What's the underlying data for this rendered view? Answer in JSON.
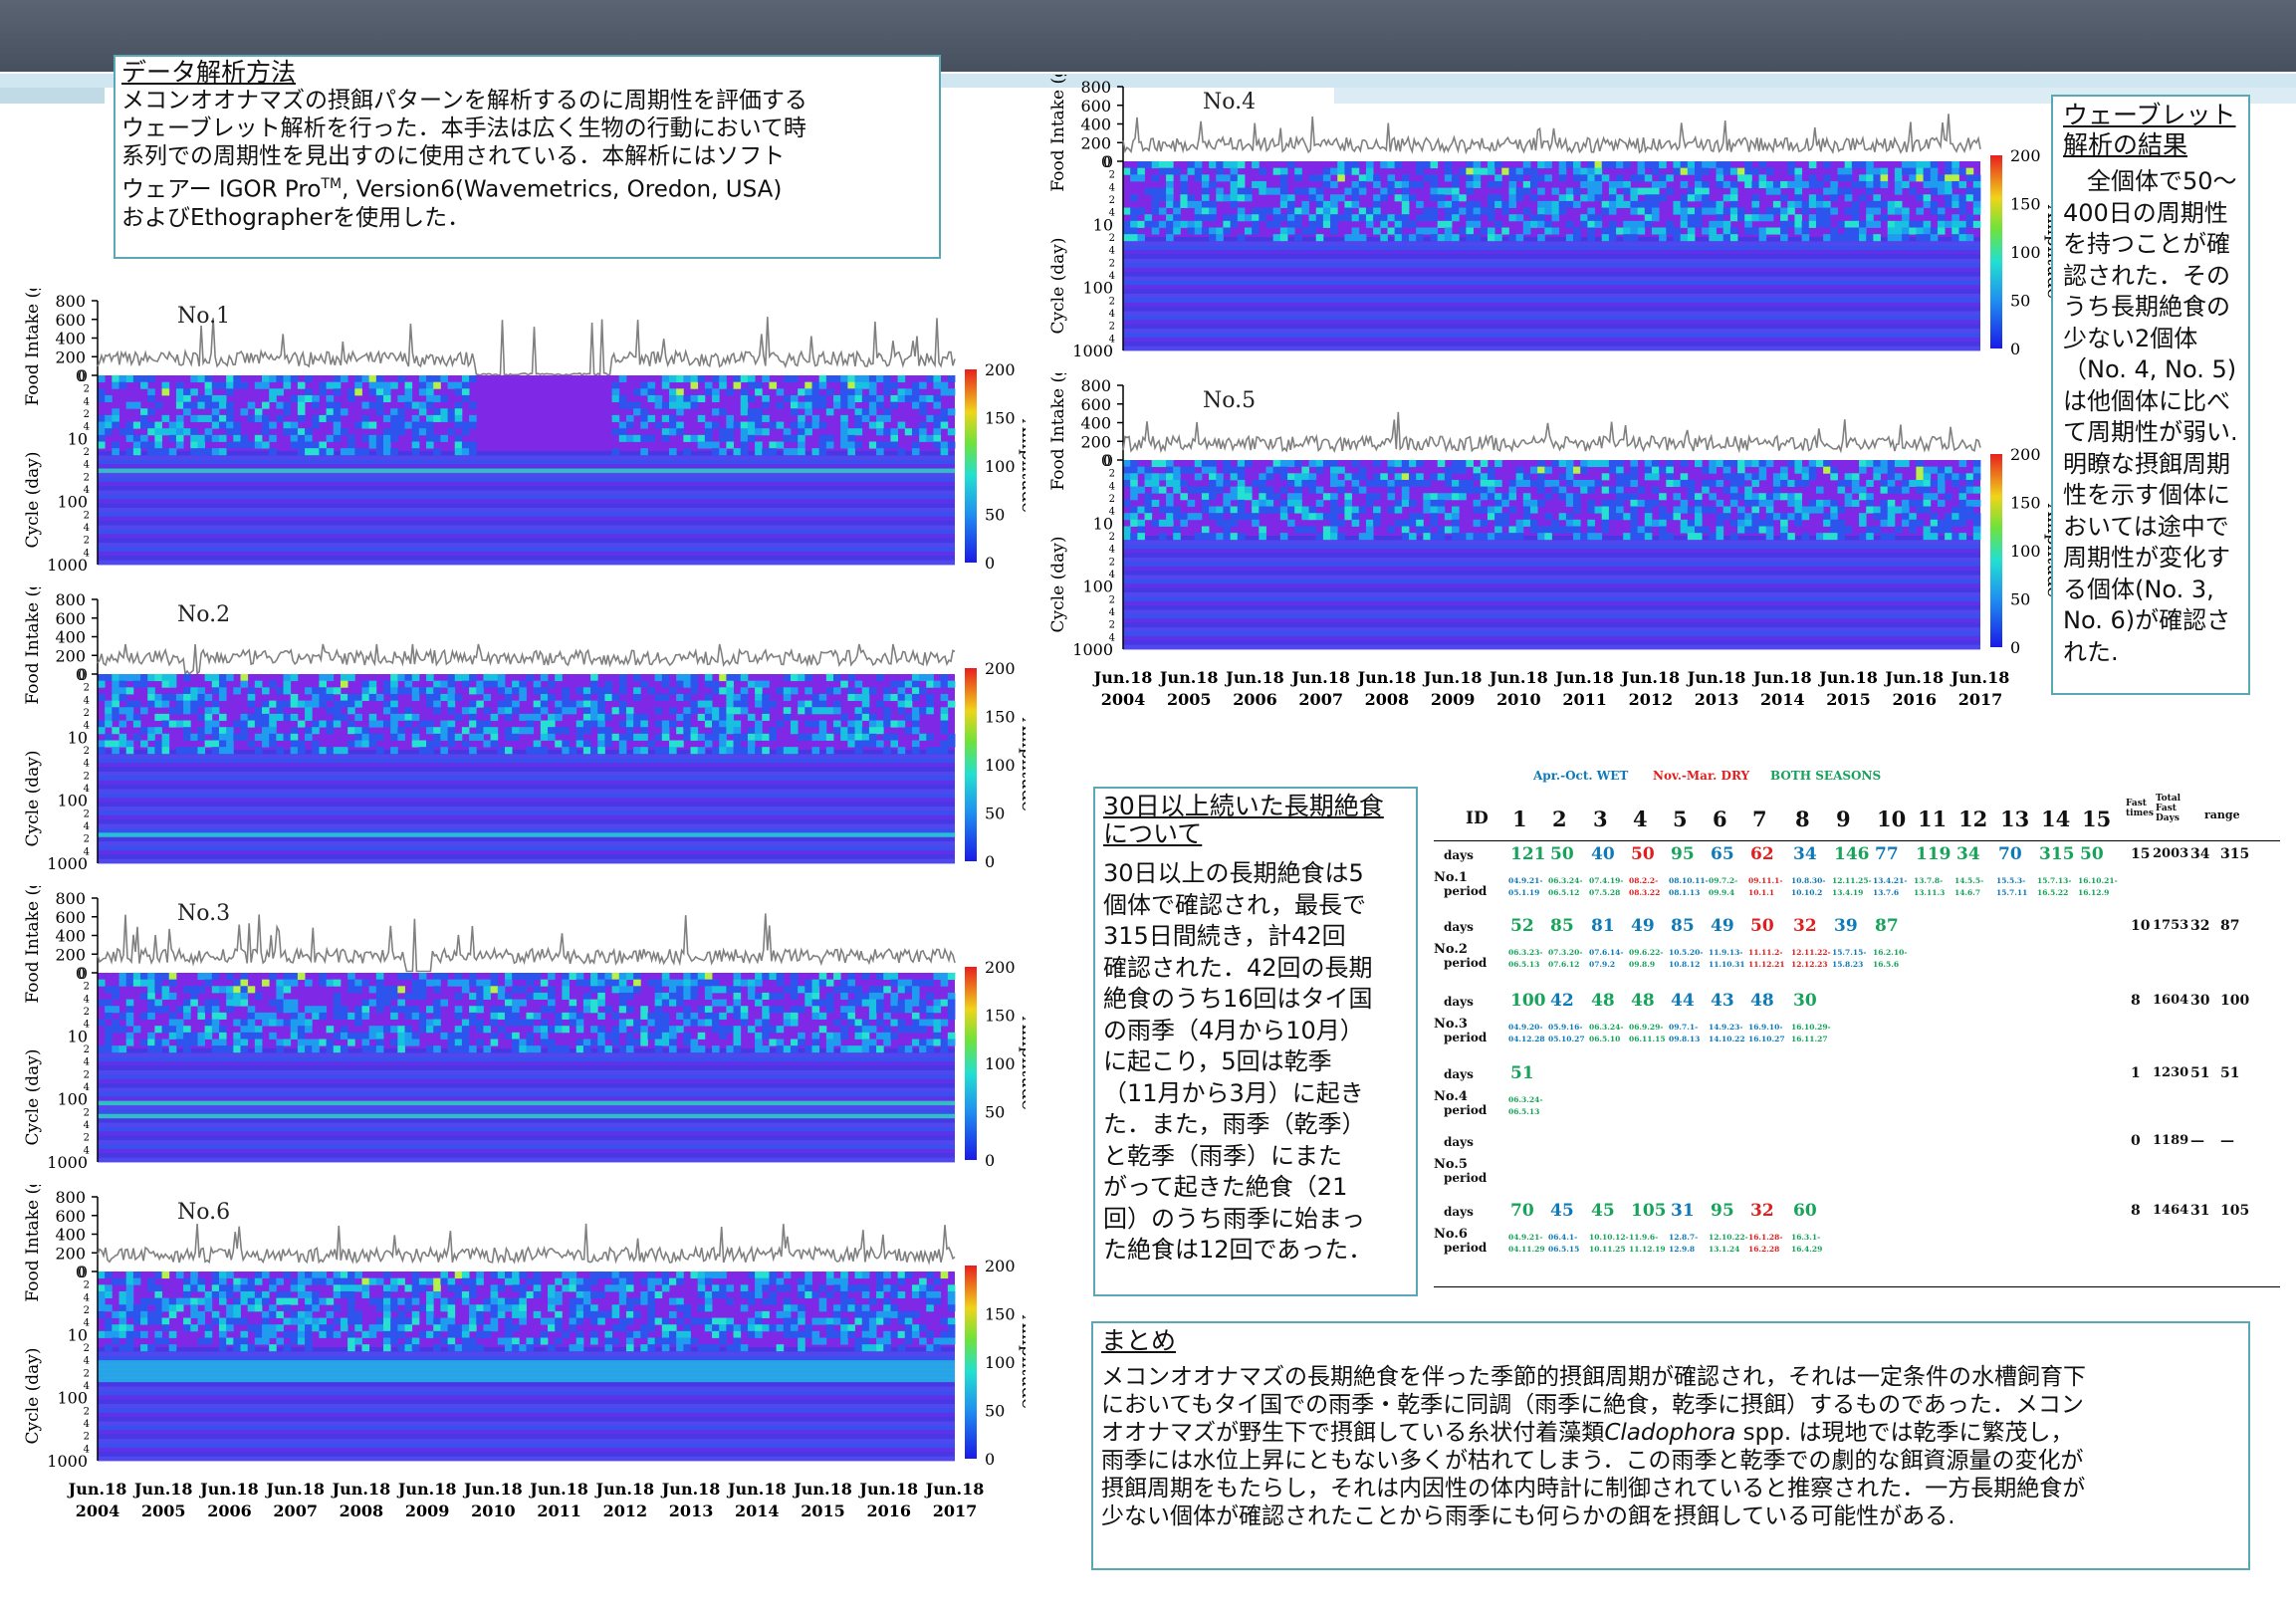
{
  "method": {
    "title": "データ解析方法",
    "body_lines": [
      "メコンオオナマズの摂餌パターンを解析するのに周期性を評価する",
      "ウェーブレット解析を行った．本手法は広く生物の行動において時",
      "系列での周期性を見出すのに使用されている．本解析にはソフト",
      "ウェアー IGOR Pro",
      "TM",
      ", Version6(Wavemetrics, Oredon, USA)",
      "およびEthographerを使用した．"
    ]
  },
  "results": {
    "title_lines": [
      "ウェーブレット",
      "解析の結果"
    ],
    "body_lines": [
      "　全個体で50～",
      "400日の周期性",
      "を持つことが確",
      "認された．その",
      "うち長期絶食の",
      "少ない2個体",
      "（No. 4, No. 5)",
      "は他個体に比べ",
      "て周期性が弱い.",
      "明瞭な摂餌周期",
      "性を示す個体に",
      "おいては途中で",
      "周期性が変化す",
      "る個体(No. 3,",
      "No. 6)が確認さ",
      "れた."
    ]
  },
  "fasting": {
    "title_lines": [
      "30日以上続いた長期絶食",
      "について"
    ],
    "body_lines": [
      "30日以上の長期絶食は5",
      "個体で確認され，最長で",
      "315日間続き，計42回",
      "確認された．42回の長期",
      "絶食のうち16回はタイ国",
      "の雨季（4月から10月）",
      "に起こり，5回は乾季",
      "（11月から3月）に起き",
      "た．また，雨季（乾季）",
      "と乾季（雨季）にまた",
      "がって起きた絶食（21",
      "回）のうち雨季に始まっ",
      "た絶食は12回であった．"
    ]
  },
  "summary": {
    "title": "まとめ",
    "body_lines": [
      "メコンオオナマズの長期絶食を伴った季節的摂餌周期が確認され，それは一定条件の水槽飼育下",
      "においてもタイ国での雨季・乾季に同調（雨季に絶食，乾季に摂餌）するものであった．メコン",
      "オオナマズが野生下で摂餌している糸状付着藻類",
      "Cladophora",
      " spp. は現地では乾季に繁茂し，",
      "雨季には水位上昇にともない多くが枯れてしまう．この雨季と乾季での劇的な餌資源量の変化が",
      "摂餌周期をもたらし，それは内因性の体内時計に制御されていると推察された．一方長期絶食が",
      "少ない個体が確認されたことから雨季にも何らかの餌を摂餌している可能性がある."
    ]
  },
  "chart_data": [
    {
      "type": "heatmap",
      "label": "No.1",
      "food_ylabel": "Food Intake (g)",
      "food_yticks": [
        0,
        200,
        400,
        600,
        800
      ],
      "cycle_ylabel": "Cycle (day)",
      "cycle_yticks": [
        "1",
        "10",
        "100",
        "1000"
      ],
      "colorbar_label": "Amplitude",
      "colorbar_ticks": [
        0,
        50,
        100,
        150,
        200
      ]
    },
    {
      "type": "heatmap",
      "label": "No.2",
      "food_ylabel": "Food Intake (g)",
      "food_yticks": [
        0,
        200,
        400,
        600,
        800
      ],
      "cycle_ylabel": "Cycle (day)",
      "cycle_yticks": [
        "1",
        "10",
        "100",
        "1000"
      ],
      "colorbar_label": "Amplitude",
      "colorbar_ticks": [
        0,
        50,
        100,
        150,
        200
      ]
    },
    {
      "type": "heatmap",
      "label": "No.3",
      "food_ylabel": "Food Intake (g)",
      "food_yticks": [
        0,
        200,
        400,
        600,
        800
      ],
      "cycle_ylabel": "Cycle (day)",
      "cycle_yticks": [
        "1",
        "10",
        "100",
        "1000"
      ],
      "colorbar_label": "Amplitude",
      "colorbar_ticks": [
        0,
        50,
        100,
        150,
        200
      ]
    },
    {
      "type": "heatmap",
      "label": "No.6",
      "food_ylabel": "Food Intake (g)",
      "food_yticks": [
        0,
        200,
        400,
        600,
        800
      ],
      "cycle_ylabel": "Cycle (day)",
      "cycle_yticks": [
        "1",
        "10",
        "100",
        "1000"
      ],
      "colorbar_label": "Amplitude",
      "colorbar_ticks": [
        0,
        50,
        100,
        150,
        200
      ],
      "xticks": [
        "Jun.18 2004",
        "Jun.18 2005",
        "Jun.18 2006",
        "Jun.18 2007",
        "Jun.18 2008",
        "Jun.18 2009",
        "Jun.18 2010",
        "Jun.18 2011",
        "Jun.18 2012",
        "Jun.18 2013",
        "Jun.18 2014",
        "Jun.18 2015",
        "Jun.18 2016",
        "Jun.18 2017"
      ]
    },
    {
      "type": "heatmap",
      "label": "No.4",
      "food_ylabel": "Food Intake (g)",
      "food_yticks": [
        0,
        200,
        400,
        600,
        800
      ],
      "cycle_ylabel": "Cycle (day)",
      "cycle_yticks": [
        "1",
        "10",
        "100",
        "1000"
      ],
      "colorbar_label": "Amplitude",
      "colorbar_ticks": [
        0,
        50,
        100,
        150,
        200
      ]
    },
    {
      "type": "heatmap",
      "label": "No.5",
      "food_ylabel": "Food Intake (g)",
      "food_yticks": [
        0,
        200,
        400,
        600,
        800
      ],
      "cycle_ylabel": "Cycle (day)",
      "cycle_yticks": [
        "1",
        "10",
        "100",
        "1000"
      ],
      "colorbar_label": "Amplitude",
      "colorbar_ticks": [
        0,
        50,
        100,
        150,
        200
      ],
      "xticks": [
        "Jun.18 2004",
        "Jun.18 2005",
        "Jun.18 2006",
        "Jun.18 2007",
        "Jun.18 2008",
        "Jun.18 2009",
        "Jun.18 2010",
        "Jun.18 2011",
        "Jun.18 2012",
        "Jun.18 2013",
        "Jun.18 2014",
        "Jun.18 2015",
        "Jun.18 2016",
        "Jun.18 2017"
      ]
    },
    {
      "type": "table",
      "legend": {
        "wet": "Apr.-Oct. WET",
        "dry": "Nov.-Mar. DRY",
        "both": "BOTH SEASONS"
      },
      "headers": [
        "ID",
        "1",
        "2",
        "3",
        "4",
        "5",
        "6",
        "7",
        "8",
        "9",
        "10",
        "11",
        "12",
        "13",
        "14",
        "15",
        "Fast times",
        "Total Fast Days",
        "range"
      ],
      "rows": [
        {
          "id": "No.1",
          "days": [
            [
              "121",
              "w"
            ],
            [
              "50",
              "w"
            ],
            [
              "40",
              "b"
            ],
            [
              "50",
              "d"
            ],
            [
              "95",
              "w"
            ],
            [
              "65",
              "b"
            ],
            [
              "62",
              "d"
            ],
            [
              "34",
              "b"
            ],
            [
              "146",
              "w"
            ],
            [
              "77",
              "b"
            ],
            [
              "119",
              "w"
            ],
            [
              "34",
              "w"
            ],
            [
              "70",
              "b"
            ],
            [
              "315",
              "w"
            ],
            [
              "50",
              "w"
            ]
          ],
          "periods": [
            [
              "04.9.21-05.1.19",
              "b"
            ],
            [
              "06.3.24-06.5.12",
              "w"
            ],
            [
              "07.4.19-07.5.28",
              "w"
            ],
            [
              "08.2.2-08.3.22",
              "d"
            ],
            [
              "08.10.11-08.1.13",
              "b"
            ],
            [
              "09.7.2-09.9.4",
              "w"
            ],
            [
              "09.11.1-10.1.1",
              "d"
            ],
            [
              "10.8.30-10.10.2",
              "b"
            ],
            [
              "12.11.25-13.4.19",
              "w"
            ],
            [
              "13.4.21-13.7.6",
              "b"
            ],
            [
              "13.7.8-13.11.3",
              "w"
            ],
            [
              "14.5.5-14.6.7",
              "w"
            ],
            [
              "15.5.3-15.7.11",
              "b"
            ],
            [
              "15.7.13-16.5.22",
              "w"
            ],
            [
              "16.10.21-16.12.9",
              "w"
            ]
          ],
          "fast": "15",
          "total": "2003",
          "range": "34",
          "range2": "315"
        },
        {
          "id": "No.2",
          "days": [
            [
              "52",
              "w"
            ],
            [
              "85",
              "w"
            ],
            [
              "81",
              "b"
            ],
            [
              "49",
              "b"
            ],
            [
              "85",
              "b"
            ],
            [
              "49",
              "b"
            ],
            [
              "50",
              "d"
            ],
            [
              "32",
              "d"
            ],
            [
              "39",
              "b"
            ],
            [
              "87",
              "w"
            ]
          ],
          "periods": [
            [
              "06.3.23-06.5.13",
              "w"
            ],
            [
              "07.3.20-07.6.12",
              "w"
            ],
            [
              "07.6.14-07.9.2",
              "b"
            ],
            [
              "09.6.22-09.8.9",
              "w"
            ],
            [
              "10.5.20-10.8.12",
              "b"
            ],
            [
              "11.9.13-11.10.31",
              "b"
            ],
            [
              "11.11.2-11.12.21",
              "d"
            ],
            [
              "12.11.22-12.12.23",
              "d"
            ],
            [
              "15.7.15-15.8.23",
              "b"
            ],
            [
              "16.2.10-16.5.6",
              "w"
            ]
          ],
          "fast": "10",
          "total": "1753",
          "range": "32",
          "range2": "87"
        },
        {
          "id": "No.3",
          "days": [
            [
              "100",
              "w"
            ],
            [
              "42",
              "b"
            ],
            [
              "48",
              "w"
            ],
            [
              "48",
              "w"
            ],
            [
              "44",
              "b"
            ],
            [
              "43",
              "b"
            ],
            [
              "48",
              "b"
            ],
            [
              "30",
              "w"
            ]
          ],
          "periods": [
            [
              "04.9.20-04.12.28",
              "b"
            ],
            [
              "05.9.16-05.10.27",
              "b"
            ],
            [
              "06.3.24-06.5.10",
              "w"
            ],
            [
              "06.9.29-06.11.15",
              "w"
            ],
            [
              "09.7.1-09.8.13",
              "b"
            ],
            [
              "14.9.23-14.10.22",
              "b"
            ],
            [
              "16.9.10-16.10.27",
              "b"
            ],
            [
              "16.10.29-16.11.27",
              "w"
            ]
          ],
          "fast": "8",
          "total": "1604",
          "range": "30",
          "range2": "100"
        },
        {
          "id": "No.4",
          "days": [
            [
              "51",
              "w"
            ]
          ],
          "periods": [
            [
              "06.3.24-06.5.13",
              "w"
            ]
          ],
          "fast": "1",
          "total": "1230",
          "range": "51",
          "range2": "51"
        },
        {
          "id": "No.5",
          "days": [],
          "periods": [],
          "fast": "0",
          "total": "1189",
          "range": "—",
          "range2": "—"
        },
        {
          "id": "No.6",
          "days": [
            [
              "70",
              "w"
            ],
            [
              "45",
              "b"
            ],
            [
              "45",
              "w"
            ],
            [
              "105",
              "w"
            ],
            [
              "31",
              "b"
            ],
            [
              "95",
              "w"
            ],
            [
              "32",
              "d"
            ],
            [
              "60",
              "w"
            ]
          ],
          "periods": [
            [
              "04.9.21-04.11.29",
              "w"
            ],
            [
              "06.4.1-06.5.15",
              "b"
            ],
            [
              "10.10.12-10.11.25",
              "w"
            ],
            [
              "11.9.6-11.12.19",
              "w"
            ],
            [
              "12.8.7-12.9.8",
              "b"
            ],
            [
              "12.10.22-13.1.24",
              "w"
            ],
            [
              "16.1.28-16.2.28",
              "d"
            ],
            [
              "16.3.1-16.4.29",
              "w"
            ]
          ],
          "fast": "8",
          "total": "1464",
          "range": "31",
          "range2": "105"
        }
      ]
    }
  ]
}
